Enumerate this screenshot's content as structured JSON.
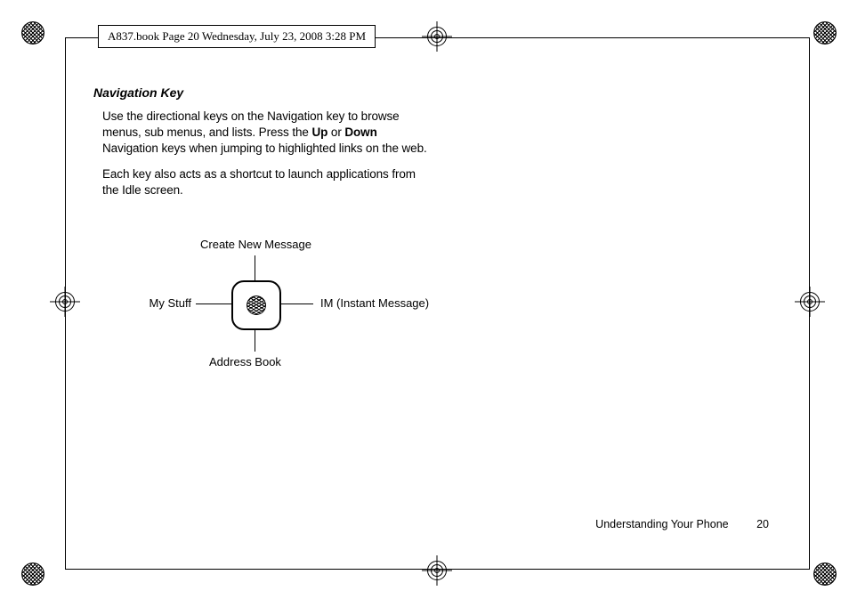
{
  "doc_tag": "A837.book  Page 20  Wednesday, July 23, 2008  3:28 PM",
  "section_heading": "Navigation Key",
  "para1_a": "Use the directional keys on the Navigation key to browse menus, sub menus, and lists. Press the ",
  "para1_b_up": "Up",
  "para1_mid": " or ",
  "para1_b_down": "Down",
  "para1_c": " Navigation keys when jumping to highlighted links on the web.",
  "para2": "Each key also acts as a shortcut to launch applications from the Idle screen.",
  "diagram": {
    "up": "Create New Message",
    "down": "Address Book",
    "left": "My Stuff",
    "right": "IM (Instant Message)"
  },
  "footer": {
    "chapter": "Understanding Your Phone",
    "page": "20"
  }
}
